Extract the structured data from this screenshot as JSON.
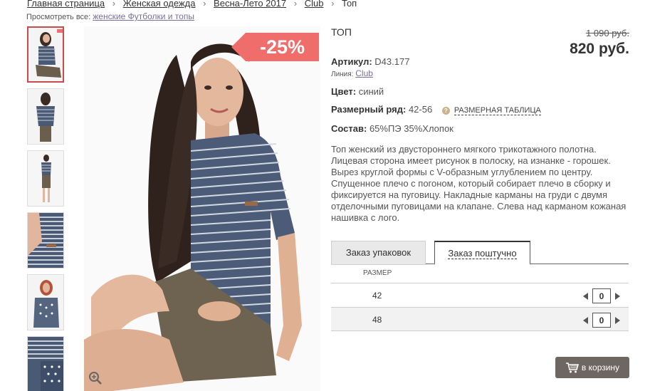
{
  "breadcrumbs": {
    "items": [
      "Главная страница",
      "Женская одежда",
      "Весна-Лето 2017",
      "Club"
    ],
    "current": "Топ",
    "separator": "›"
  },
  "view_all": {
    "label": "Просмотреть все:",
    "link": "женские Футболки и топы"
  },
  "gallery": {
    "discount_badge": "-25%",
    "thumbnail_count": 6,
    "zoom_icon": "zoom-icon"
  },
  "product": {
    "title": "ТОП",
    "old_price": "1 090 руб.",
    "price": "820 руб.",
    "article_label": "Артикул:",
    "article_value": "D43.177",
    "line_label": "Линия:",
    "line_value": "Club",
    "color_label": "Цвет:",
    "color_value": "синий",
    "size_range_label": "Размерный ряд:",
    "size_range_value": "42-56",
    "size_chart_label": "РАЗМЕРНАЯ ТАБЛИЦА",
    "composition_label": "Состав:",
    "composition_value": "65%ПЭ 35%Хлопок",
    "description": "Топ женский из двустороннего мягкого трикотажного полотна. Лицевая сторона имеет рисунок в полоску, на изнанке - горошек. Вырез круглой формы с V-образным углублением по центру. Спущенное плечо с погоном, который собирает плечо в сборку и фиксируется на пуговицу. Накладные карманы на груди с двумя отделочными пуговицами на клапане. Слева над карманом кожаная нашивка с лого."
  },
  "order_tabs": [
    {
      "label": "Заказ упаковок",
      "active": false
    },
    {
      "label": "Заказ поштучно",
      "active": true
    }
  ],
  "size_table": {
    "header": "РАЗМЕР",
    "rows": [
      {
        "size": "42",
        "qty": "0"
      },
      {
        "size": "48",
        "qty": "0"
      }
    ]
  },
  "cart_button": {
    "label": "в корзину",
    "icon": "cart-icon"
  },
  "colors": {
    "accent": "#ef6d6a",
    "button": "#6d6661",
    "link": "#7a6f9a",
    "active_thumb": "#c94b4b"
  }
}
